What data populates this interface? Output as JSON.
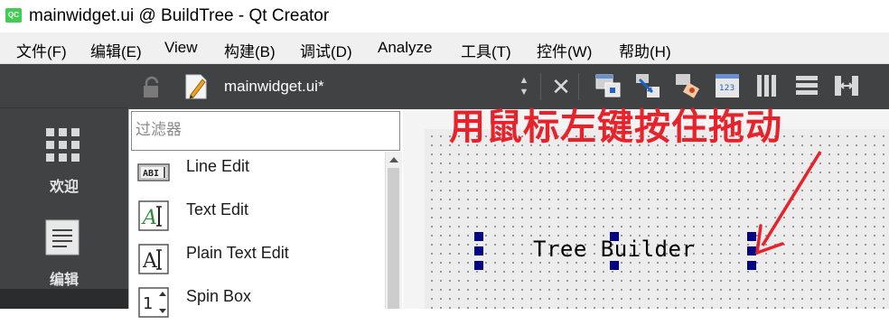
{
  "window": {
    "title": "mainwidget.ui @ BuildTree - Qt Creator",
    "app_icon_text": "QC"
  },
  "menubar": {
    "items": [
      "文件(F)",
      "编辑(E)",
      "View",
      "构建(B)",
      "调试(D)",
      "Analyze",
      "工具(T)",
      "控件(W)",
      "帮助(H)"
    ]
  },
  "editor_toolbar": {
    "file_name": "mainwidget.ui*",
    "icons": [
      "lock-icon",
      "ui-file-icon",
      "up-down-arrows-icon",
      "close-document-icon",
      "edit-widgets-icon",
      "edit-signals-slots-icon",
      "edit-buddies-icon",
      "edit-tab-order-icon",
      "layout-horizontal-icon",
      "layout-vertical-icon",
      "layout-horizontal-splitter-icon"
    ]
  },
  "modes": [
    {
      "label": "欢迎",
      "icon": "welcome-grid-icon"
    },
    {
      "label": "编辑",
      "icon": "edit-document-icon"
    }
  ],
  "widget_box": {
    "filter_placeholder": "过滤器",
    "items": [
      {
        "label": "Line Edit",
        "icon": "line-edit-icon"
      },
      {
        "label": "Text Edit",
        "icon": "text-edit-icon"
      },
      {
        "label": "Plain Text Edit",
        "icon": "plain-text-edit-icon"
      },
      {
        "label": "Spin Box",
        "icon": "spin-box-icon"
      }
    ]
  },
  "form": {
    "label_text": "Tree Builder"
  },
  "annotation": {
    "text": "用鼠标左键按住拖动",
    "color": "#e8222a"
  },
  "colors": {
    "sidebar_dark": "#404244",
    "selection_handle": "#00008b",
    "accent_blue": "#1e64c8"
  }
}
